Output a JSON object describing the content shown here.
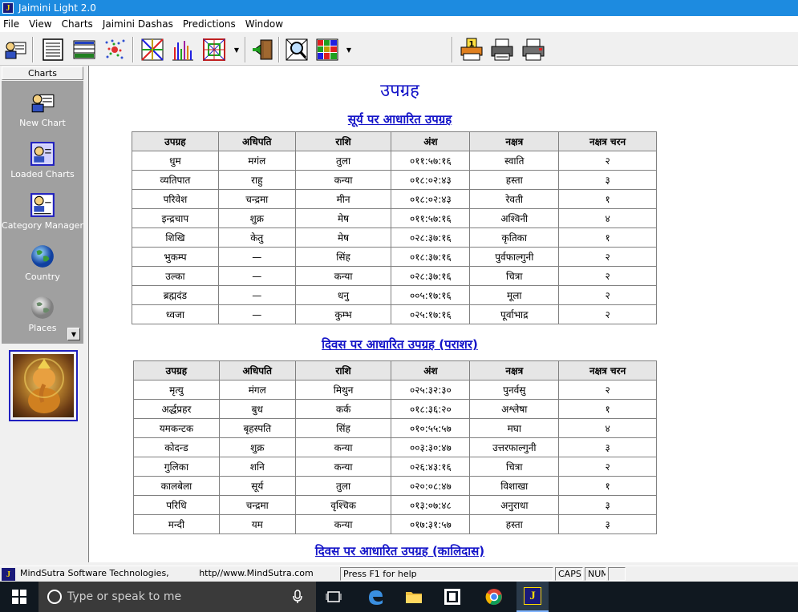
{
  "window": {
    "title": "Jaimini Light 2.0",
    "icon_letter": "J"
  },
  "menu": [
    "File",
    "View",
    "Charts",
    "Jaimini Dashas",
    "Predictions",
    "Window"
  ],
  "sidebar": {
    "header": "Charts",
    "items": [
      {
        "label": "New Chart",
        "icon": "new-chart-icon"
      },
      {
        "label": "Loaded Charts",
        "icon": "loaded-charts-icon"
      },
      {
        "label": "Category Manager",
        "icon": "category-manager-icon"
      },
      {
        "label": "Country",
        "icon": "globe-icon"
      },
      {
        "label": "Places",
        "icon": "places-icon"
      }
    ]
  },
  "content": {
    "title": "उपग्रह",
    "section1": {
      "title": "सूर्य पर आधारित उपग्रह",
      "headers": [
        "उपग्रह",
        "अधिपति",
        "राशि",
        "अंश",
        "नक्षत्र",
        "नक्षत्र चरन"
      ],
      "rows": [
        [
          "धुम",
          "मगंल",
          "तुला",
          "०११:५७:१६",
          "स्वाति",
          "२"
        ],
        [
          "व्यतिपात",
          "राहु",
          "कन्या",
          "०१८:०२:४३",
          "हस्ता",
          "३"
        ],
        [
          "परिवेश",
          "चन्द्रमा",
          "मीन",
          "०१८:०२:४३",
          "रेवती",
          "१"
        ],
        [
          "इन्द्रचाप",
          "शुक्र",
          "मेष",
          "०११:५७:१६",
          "अश्विनी",
          "४"
        ],
        [
          "शिखि",
          "केतु",
          "मेष",
          "०२८:३७:१६",
          "कृतिका",
          "१"
        ],
        [
          "भुकम्प",
          "—",
          "सिंह",
          "०१८:३७:१६",
          "पुर्वफाल्गुनी",
          "२"
        ],
        [
          "उल्का",
          "—",
          "कन्या",
          "०२८:३७:१६",
          "चित्रा",
          "२"
        ],
        [
          "ब्रह्मदंड",
          "—",
          "धनु",
          "००५:१७:१६",
          "मूला",
          "२"
        ],
        [
          "ध्वजा",
          "—",
          "कुम्भ",
          "०२५:१७:१६",
          "पूर्वाभाद्र",
          "२"
        ]
      ]
    },
    "section2": {
      "title": "दिवस पर आधारित उपग्रह (पराशर)",
      "headers": [
        "उपग्रह",
        "अधिपति",
        "राशि",
        "अंश",
        "नक्षत्र",
        "नक्षत्र चरन"
      ],
      "rows": [
        [
          "मृत्यु",
          "मंगल",
          "मिथुन",
          "०२५:३२:३०",
          "पुनर्वसु",
          "२"
        ],
        [
          "अर्द्धप्रहर",
          "बुध",
          "कर्क",
          "०१८:३६:२०",
          "अश्लेषा",
          "१"
        ],
        [
          "यमकन्टक",
          "बृहस्पति",
          "सिंह",
          "०१०:५५:५७",
          "मघा",
          "४"
        ],
        [
          "कोदन्ड",
          "शुक्र",
          "कन्या",
          "००३:३०:४७",
          "उत्तरफाल्गुनी",
          "३"
        ],
        [
          "गुलिका",
          "शनि",
          "कन्या",
          "०२६:४३:१६",
          "चित्रा",
          "२"
        ],
        [
          "कालबेला",
          "सूर्य",
          "तुला",
          "०२०:०८:४७",
          "विशाखा",
          "१"
        ],
        [
          "परिधि",
          "चन्द्रमा",
          "वृश्चिक",
          "०१३:०७:४८",
          "अनुराधा",
          "३"
        ],
        [
          "मन्दी",
          "यम",
          "कन्या",
          "०१७:३१:५७",
          "हस्ता",
          "३"
        ]
      ]
    },
    "section3": {
      "title": "दिवस पर आधारित उपग्रह (कालिदास)"
    }
  },
  "status": {
    "company": "MindSutra Software Technologies,",
    "url": "http//www.MindSutra.com",
    "help": "Press F1 for help",
    "caps": "CAPS",
    "num": "NUM"
  },
  "taskbar": {
    "search_placeholder": "Type or speak to me"
  }
}
